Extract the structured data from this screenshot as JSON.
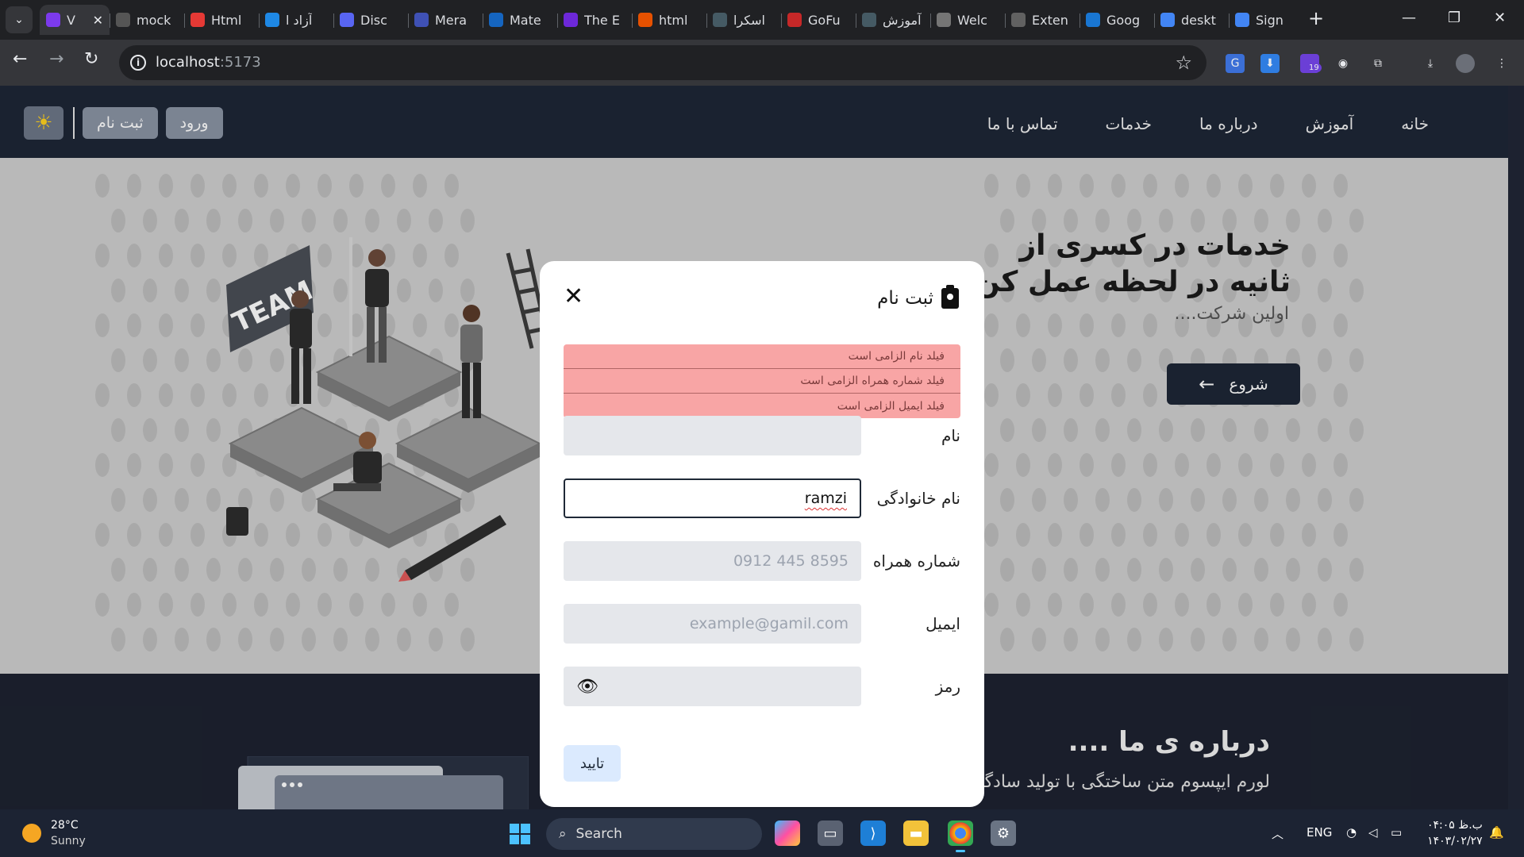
{
  "browser": {
    "tabs": [
      {
        "title": "V",
        "fav_color": "#7c3aed",
        "active": true
      },
      {
        "title": "mock",
        "fav_color": "#555555"
      },
      {
        "title": "Html",
        "fav_color": "#e53935"
      },
      {
        "title": "آزاد ا",
        "fav_color": "#1e88e5"
      },
      {
        "title": "Disc",
        "fav_color": "#5865f2"
      },
      {
        "title": "Mera",
        "fav_color": "#3f51b5"
      },
      {
        "title": "Mate",
        "fav_color": "#1565c0"
      },
      {
        "title": "The E",
        "fav_color": "#6d28d9"
      },
      {
        "title": "html",
        "fav_color": "#e65100"
      },
      {
        "title": "اسکرا",
        "fav_color": "#455a64"
      },
      {
        "title": "GoFu",
        "fav_color": "#c62828"
      },
      {
        "title": "آموزش",
        "fav_color": "#455a64"
      },
      {
        "title": "Welc",
        "fav_color": "#757575"
      },
      {
        "title": "Exten",
        "fav_color": "#616161"
      },
      {
        "title": "Goog",
        "fav_color": "#1976d2"
      },
      {
        "title": "deskt",
        "fav_color": "#4285f4"
      },
      {
        "title": "Sign",
        "fav_color": "#4285f4"
      }
    ],
    "url_host": "localhost",
    "url_port": ":5173",
    "ext_badge": "19"
  },
  "site": {
    "nav": [
      "خانه",
      "آموزش",
      "درباره ما",
      "خدمات",
      "تماس با ما"
    ],
    "signup_btn": "ثبت نام",
    "login_btn": "ورود",
    "hero_title": "خدمات در کسری از ثانیه در لحظه عمل کن",
    "hero_sub": "اولین شرکت....",
    "start_btn": "شروع",
    "about_title": "درباره ی ما ....",
    "about_text": "لورم ایپسوم متن ساختگی با تولید سادگی نامفهوم از صنعت چاپ، و با استفاده از طراحان"
  },
  "modal": {
    "title": "ثبت نام",
    "errors": [
      "فیلد نام الزامی است",
      "فیلد شماره همراه الزامی است",
      "فیلد ایمیل الزامی است"
    ],
    "fields": {
      "first_name": {
        "label": "نام",
        "value": "",
        "placeholder": ""
      },
      "last_name": {
        "label": "نام خانوادگی",
        "value": "ramzi"
      },
      "phone": {
        "label": "شماره همراه",
        "placeholder": "0912 445 8595"
      },
      "email": {
        "label": "ایمیل",
        "placeholder": "example@gamil.com"
      },
      "password": {
        "label": "رمز",
        "value": ""
      }
    },
    "submit": "تایید"
  },
  "taskbar": {
    "temp": "28°C",
    "condition": "Sunny",
    "search": "Search",
    "lang": "ENG",
    "time": "۰۴:۰۵ ب.ظ",
    "date": "۱۴۰۳/۰۲/۲۷"
  }
}
